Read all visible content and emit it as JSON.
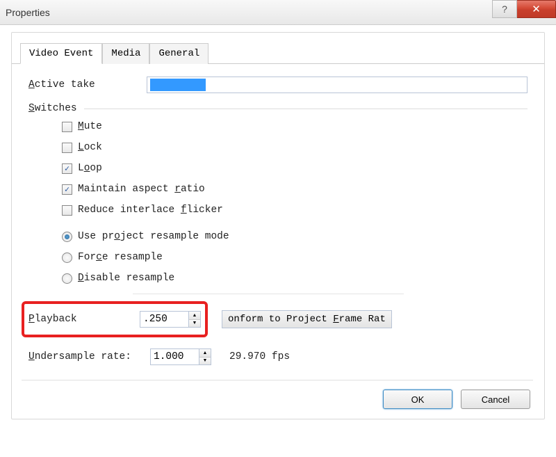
{
  "window": {
    "title": "Properties"
  },
  "tabs": {
    "items": [
      {
        "label": "Video Event",
        "active": true
      },
      {
        "label": "Media",
        "active": false
      },
      {
        "label": "General",
        "active": false
      }
    ]
  },
  "active_take": {
    "label": "Active take",
    "u": "A",
    "value": ""
  },
  "switches": {
    "label": "Switches",
    "u": "S",
    "items": [
      {
        "label": "Mute",
        "u": "M",
        "checked": false
      },
      {
        "label": "Lock",
        "u": "L",
        "checked": false
      },
      {
        "label": "Loop",
        "u": "o",
        "checked": true
      },
      {
        "label": "Maintain aspect ratio",
        "u": "r",
        "checked": true
      },
      {
        "label": "Reduce interlace flicker",
        "u": "f",
        "checked": false
      }
    ]
  },
  "resample": {
    "options": [
      {
        "label": "Use project resample mode",
        "u": "o",
        "selected": true
      },
      {
        "label": "Force resample",
        "u": "c",
        "selected": false
      },
      {
        "label": "Disable resample",
        "u": "D",
        "selected": false
      }
    ]
  },
  "playback": {
    "label": "Playback",
    "u": "P",
    "value": ".250",
    "conform_btn": "onform to Project Frame Rat",
    "conform_u": "F"
  },
  "undersample": {
    "label": "Undersample rate:",
    "u": "U",
    "value": "1.000",
    "fps": "29.970 fps"
  },
  "buttons": {
    "ok": "OK",
    "cancel": "Cancel"
  }
}
